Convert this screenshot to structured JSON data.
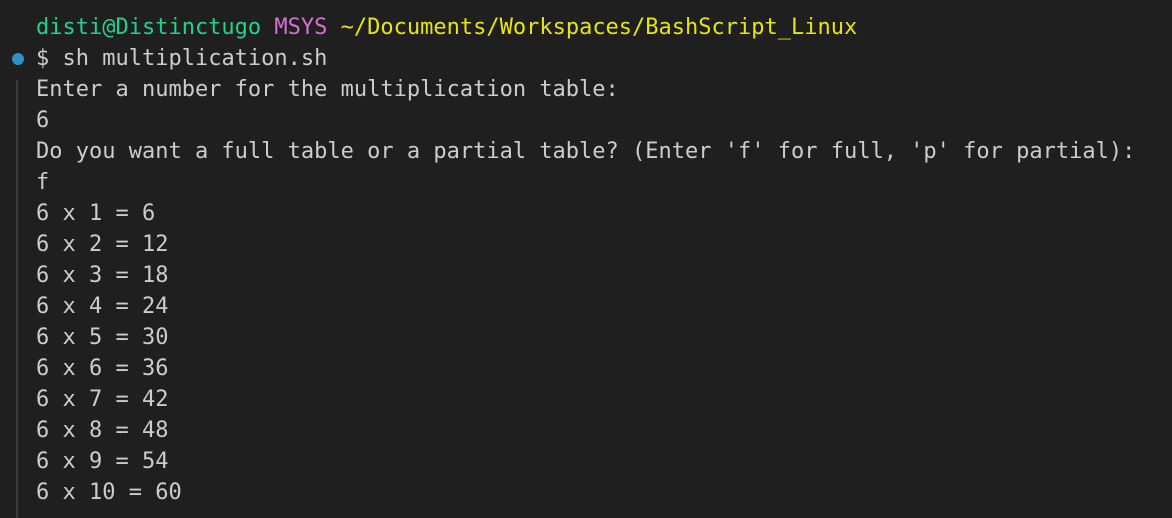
{
  "prompt": {
    "user_host": "disti@Distinctugo",
    "system": "MSYS",
    "path": "~/Documents/Workspaces/BashScript_Linux",
    "colors": {
      "user": "#23d18b",
      "system": "#d670d6",
      "path": "#e5e510"
    }
  },
  "command": {
    "prefix": "$ ",
    "text": "sh multiplication.sh"
  },
  "output": [
    "Enter a number for the multiplication table:",
    "6",
    "Do you want a full table or a partial table? (Enter 'f' for full, 'p' for partial):",
    "f",
    "6 x 1 = 6",
    "6 x 2 = 12",
    "6 x 3 = 18",
    "6 x 4 = 24",
    "6 x 5 = 30",
    "6 x 6 = 36",
    "6 x 7 = 42",
    "6 x 8 = 48",
    "6 x 9 = 54",
    "6 x 10 = 60"
  ],
  "status_indicator": {
    "icon": "command-status-dot-icon",
    "color": "#2f8fc6"
  },
  "theme": {
    "background": "#1f1f1f",
    "foreground": "#cccccc"
  }
}
